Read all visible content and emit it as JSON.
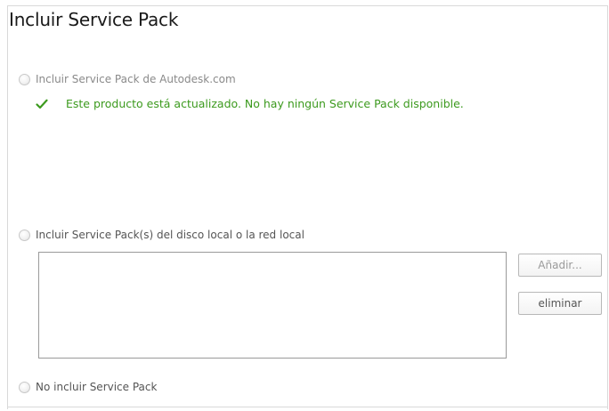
{
  "section": {
    "title": "Incluir Service Pack"
  },
  "options": {
    "autodesk": {
      "label": "Incluir Service Pack de Autodesk.com",
      "status_icon": "check-icon",
      "status_text": "Este producto está actualizado. No hay ningún Service Pack disponible.",
      "status_color": "#3c9a1e"
    },
    "local": {
      "label": "Incluir Service Pack(s) del disco local o la red local",
      "add_button": "Añadir...",
      "remove_button": "eliminar",
      "items": []
    },
    "none": {
      "label": "No incluir Service Pack"
    }
  }
}
